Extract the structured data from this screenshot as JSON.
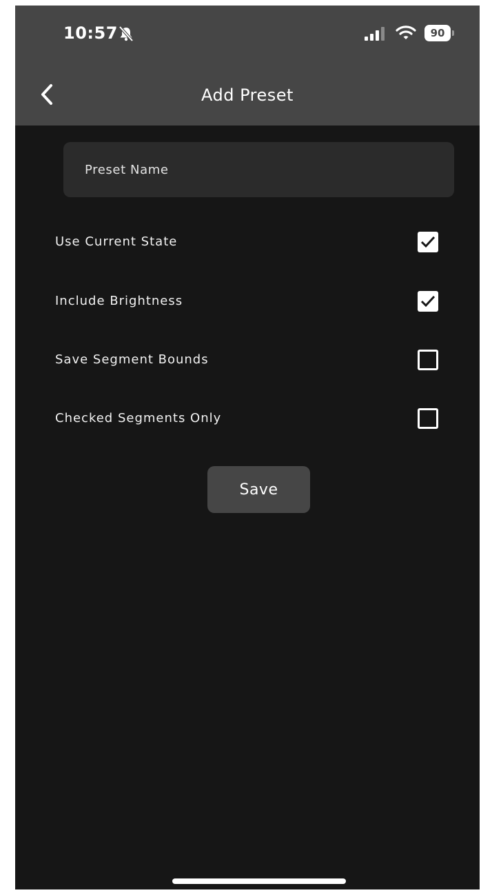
{
  "status_bar": {
    "time": "10:57",
    "battery": "90",
    "icons": [
      "bell-slash-icon",
      "cellular-signal-icon",
      "wifi-icon",
      "battery-icon"
    ]
  },
  "header": {
    "title": "Add Preset",
    "back_icon": "chevron-left-icon"
  },
  "form": {
    "name_placeholder": "Preset Name",
    "name_value": ""
  },
  "options": {
    "use_current_state": {
      "label": "Use Current State",
      "checked": true
    },
    "include_brightness": {
      "label": "Include Brightness",
      "checked": true
    },
    "save_segment_bounds": {
      "label": "Save Segment Bounds",
      "checked": false
    },
    "checked_segments_only": {
      "label": "Checked Segments Only",
      "checked": false
    }
  },
  "actions": {
    "save_label": "Save"
  },
  "colors": {
    "background": "#161616",
    "header": "#464646",
    "input": "#2b2b2b",
    "button": "#464646",
    "text": "#ffffff"
  }
}
